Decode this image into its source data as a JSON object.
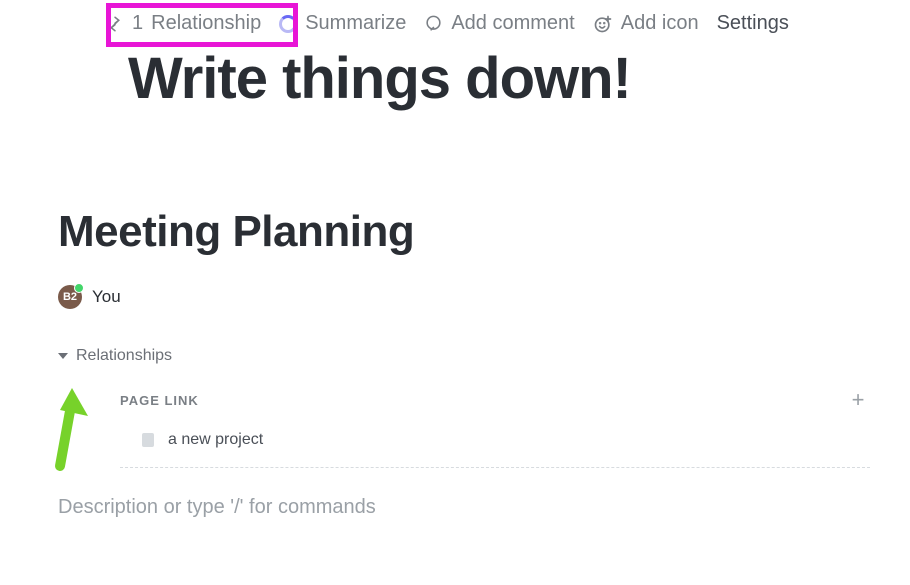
{
  "toolbar": {
    "relationship": {
      "count_label": "1",
      "label": "Relationship"
    },
    "summarize_label": "Summarize",
    "add_comment_label": "Add comment",
    "add_icon_label": "Add icon",
    "settings_label": "Settings"
  },
  "main_title": "Write things down!",
  "page": {
    "title": "Meeting Planning",
    "author": {
      "avatar_initials": "B2",
      "name": "You"
    },
    "relationships_label": "Relationships",
    "pagelink": {
      "header_label": "PAGE LINK",
      "items": [
        "a new project"
      ]
    },
    "description_placeholder": "Description or type '/' for commands"
  }
}
